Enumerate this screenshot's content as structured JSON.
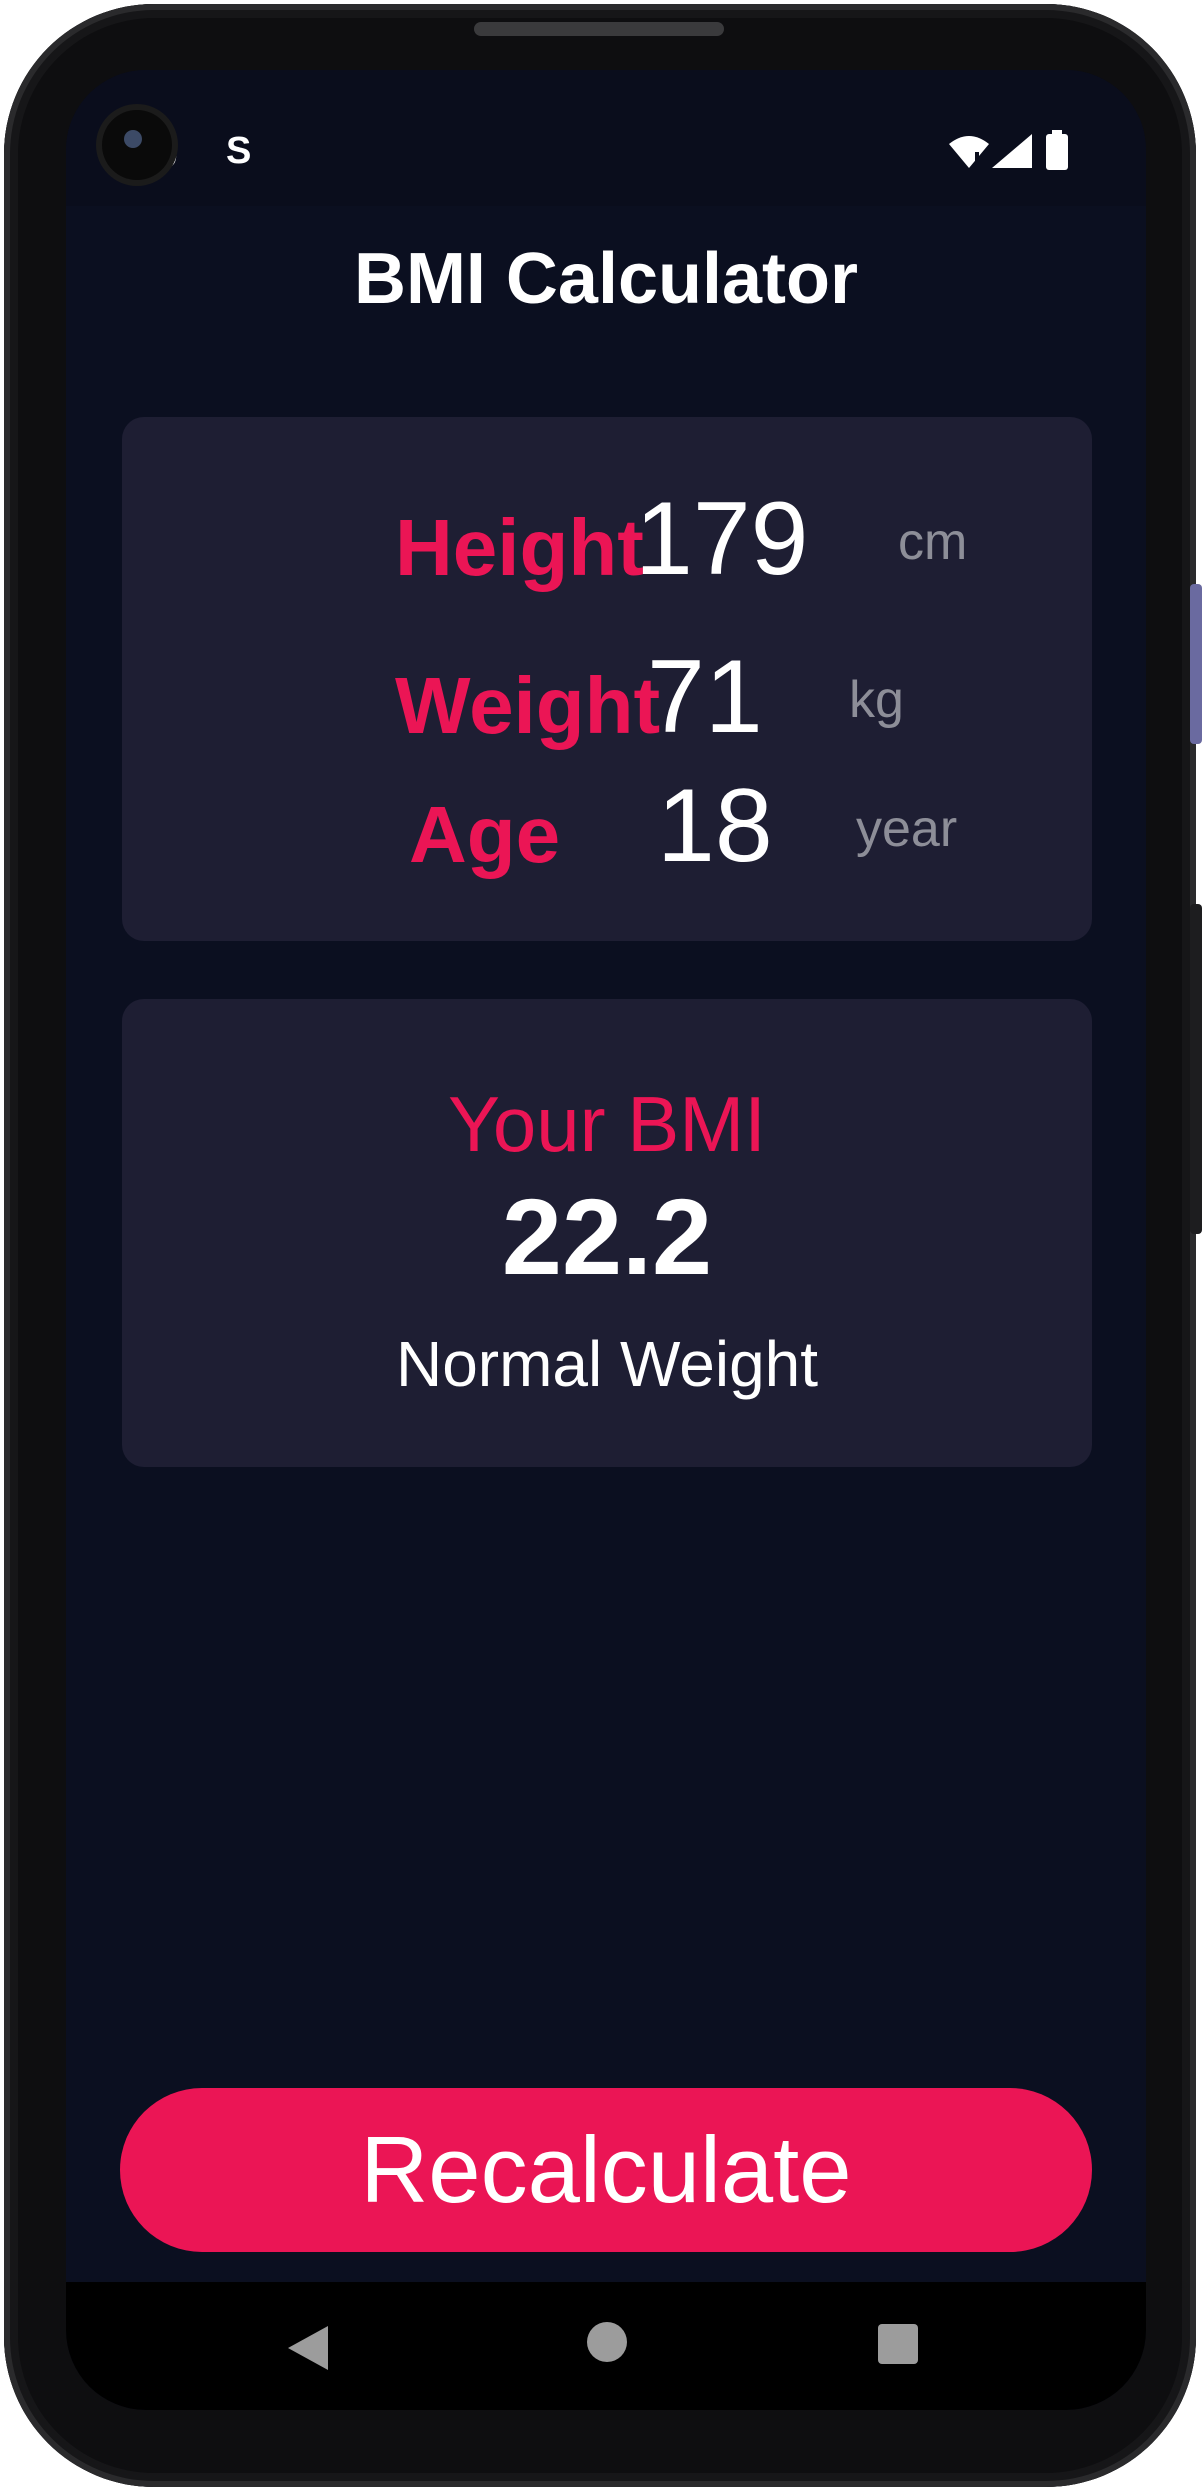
{
  "status_bar": {
    "time": "9",
    "notification_icon": "S"
  },
  "app": {
    "title": "BMI Calculator"
  },
  "inputs": {
    "height": {
      "label": "Height",
      "value": "179",
      "unit": "cm"
    },
    "weight": {
      "label": "Weight",
      "value": "71",
      "unit": "kg"
    },
    "age": {
      "label": "Age",
      "value": "18",
      "unit": "year"
    }
  },
  "result": {
    "label": "Your BMI",
    "value": "22.2",
    "category": "Normal Weight"
  },
  "actions": {
    "recalculate_label": "Recalculate"
  },
  "colors": {
    "accent": "#eb1555",
    "background": "#0b0f20",
    "card": "#1e1e33",
    "unit_text": "#8d8e98"
  },
  "icons": [
    "camera-icon",
    "wifi-icon",
    "signal-icon",
    "battery-icon",
    "back-icon",
    "home-icon",
    "recents-icon"
  ]
}
